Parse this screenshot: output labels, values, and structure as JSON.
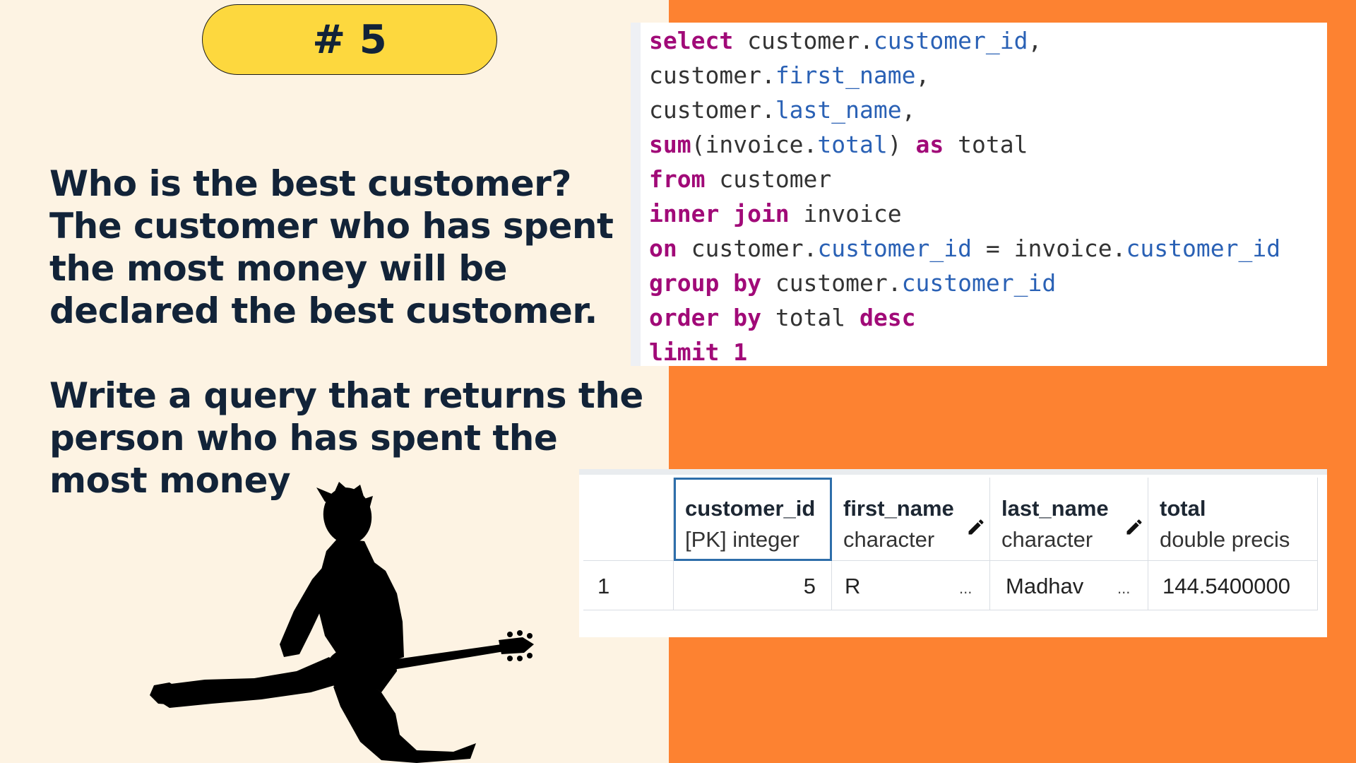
{
  "badge": {
    "label": "# 5"
  },
  "question": {
    "lines": [
      "Who is the best customer?",
      "The customer who has spent",
      "the most money will be",
      "declared the best customer."
    ],
    "task_lines": [
      "Write a query that returns the",
      "person who has spent the",
      "most money"
    ]
  },
  "sql": {
    "lines": [
      [
        {
          "t": "select",
          "c": "kw"
        },
        {
          "t": " customer.",
          "c": "plain"
        },
        {
          "t": "customer_id",
          "c": "col"
        },
        {
          "t": ",",
          "c": "plain"
        }
      ],
      [
        {
          "t": "customer.",
          "c": "plain"
        },
        {
          "t": "first_name",
          "c": "col"
        },
        {
          "t": ",",
          "c": "plain"
        }
      ],
      [
        {
          "t": "customer.",
          "c": "plain"
        },
        {
          "t": "last_name",
          "c": "col"
        },
        {
          "t": ",",
          "c": "plain"
        }
      ],
      [
        {
          "t": "sum",
          "c": "kw"
        },
        {
          "t": "(invoice.",
          "c": "plain"
        },
        {
          "t": "total",
          "c": "col"
        },
        {
          "t": ") ",
          "c": "plain"
        },
        {
          "t": "as",
          "c": "kw"
        },
        {
          "t": " total",
          "c": "plain"
        }
      ],
      [
        {
          "t": "from",
          "c": "kw"
        },
        {
          "t": " customer",
          "c": "plain"
        }
      ],
      [
        {
          "t": "inner join",
          "c": "kw"
        },
        {
          "t": " invoice",
          "c": "plain"
        }
      ],
      [
        {
          "t": "on",
          "c": "kw"
        },
        {
          "t": " customer.",
          "c": "plain"
        },
        {
          "t": "customer_id",
          "c": "col"
        },
        {
          "t": " = invoice.",
          "c": "plain"
        },
        {
          "t": "customer_id",
          "c": "col"
        }
      ],
      [
        {
          "t": "group by",
          "c": "kw"
        },
        {
          "t": " customer.",
          "c": "plain"
        },
        {
          "t": "customer_id",
          "c": "col"
        }
      ],
      [
        {
          "t": "order by",
          "c": "kw"
        },
        {
          "t": " total ",
          "c": "plain"
        },
        {
          "t": "desc",
          "c": "kw"
        }
      ],
      [
        {
          "t": "limit",
          "c": "kw"
        },
        {
          "t": " 1",
          "c": "kw"
        }
      ]
    ]
  },
  "result": {
    "columns": [
      {
        "name": "customer_id",
        "type": "[PK] integer"
      },
      {
        "name": "first_name",
        "type": "character"
      },
      {
        "name": "last_name",
        "type": "character"
      },
      {
        "name": "total",
        "type": "double precis"
      }
    ],
    "rows": [
      {
        "row_num": "1",
        "customer_id": "5",
        "first_name": "R",
        "last_name": "Madhav",
        "total": "144.5400000"
      }
    ],
    "ellipsis": "...",
    "icons": [
      "pencil-icon"
    ]
  },
  "colors": {
    "background": "#fdf3e3",
    "accent_orange": "#fd8231",
    "badge_yellow": "#fdd83e",
    "text_navy": "#122338",
    "sql_keyword": "#a10a78",
    "sql_column": "#2a61b5"
  }
}
